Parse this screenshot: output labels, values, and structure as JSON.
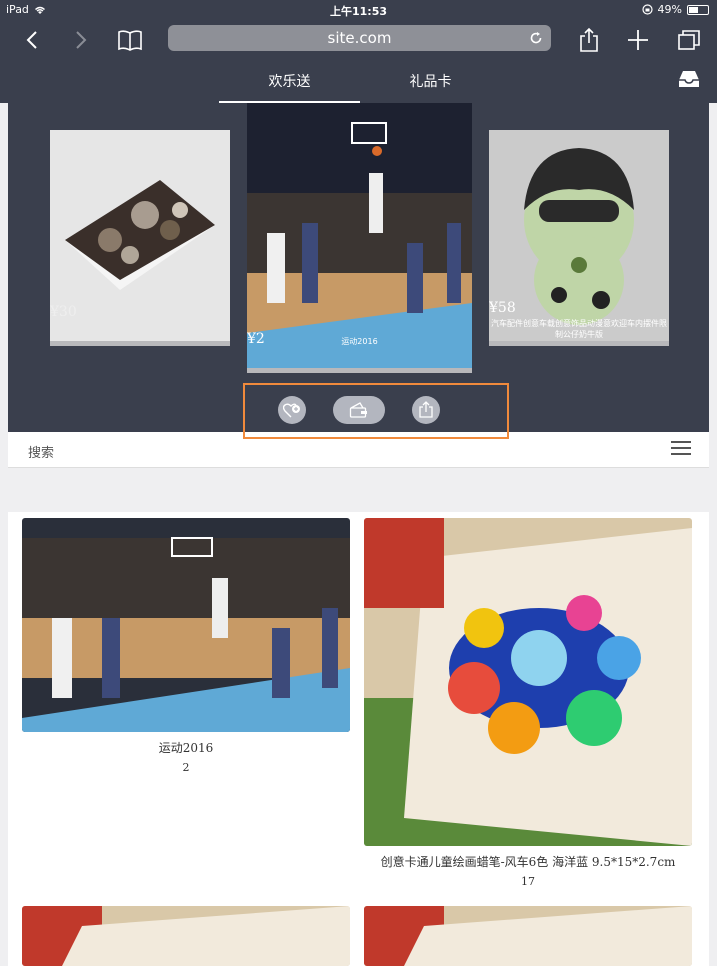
{
  "status": {
    "device": "iPad",
    "time": "上午11:53",
    "battery": "49%",
    "battery_level": 0.49
  },
  "browser": {
    "url": "site.com"
  },
  "tabs": [
    {
      "label": "欢乐送",
      "active": true
    },
    {
      "label": "礼品卡",
      "active": false
    }
  ],
  "carousel": {
    "cards": [
      {
        "price": "¥30",
        "caption": ""
      },
      {
        "price": "¥2",
        "caption": "运动2016"
      },
      {
        "price": "¥58",
        "caption": "汽车配件创意车载创意饰品动漫意欢迎车内摆件限制公仔奶牛版"
      }
    ]
  },
  "actions": [
    {
      "icon": "heart-plus-icon"
    },
    {
      "icon": "wallet-icon"
    },
    {
      "icon": "share-icon"
    }
  ],
  "search": {
    "label": "搜索"
  },
  "products": [
    {
      "title": "运动2016",
      "count": "2"
    },
    {
      "title": "创意卡通儿童绘画蜡笔-风车6色 海洋蓝 9.5*15*2.7cm",
      "count": "17"
    }
  ],
  "colors": {
    "header": "#3a3f4d",
    "highlight": "#f08a3c"
  }
}
